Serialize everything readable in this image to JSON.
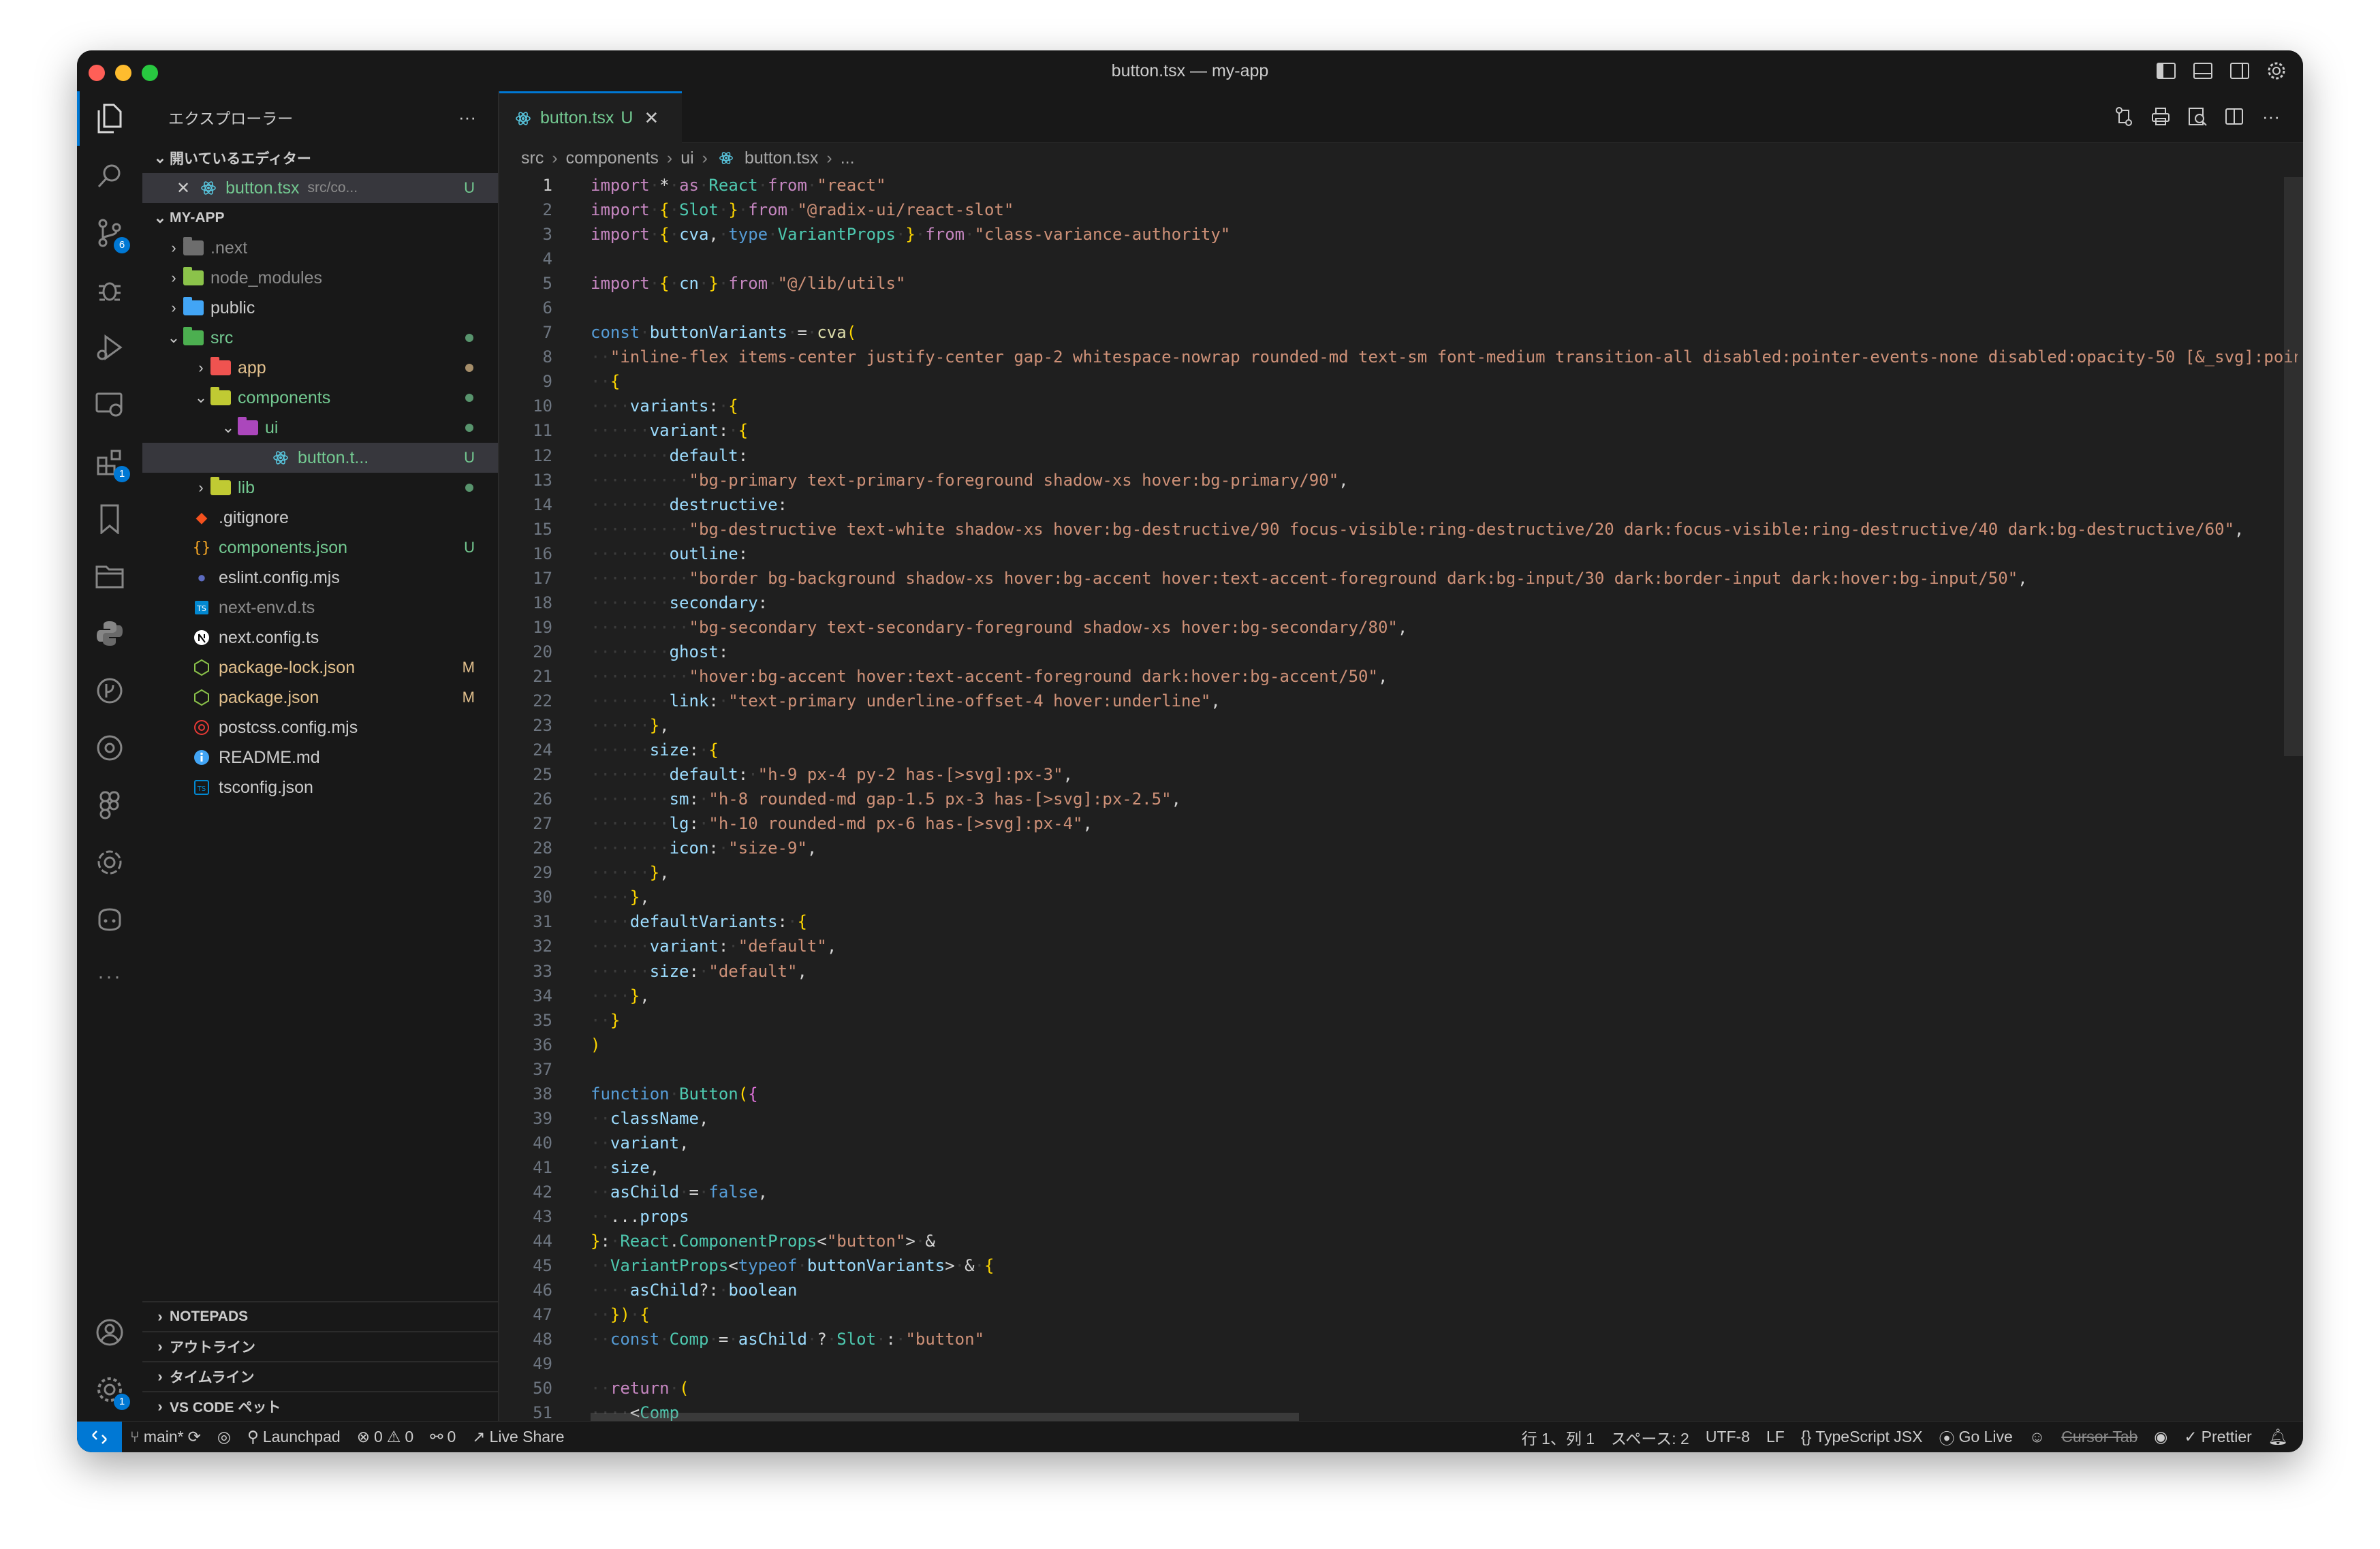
{
  "window": {
    "title": "button.tsx — my-app"
  },
  "sidebar": {
    "explorer_title": "エクスプローラー",
    "more": "···",
    "open_editors_title": "開いているエディター",
    "open_editor": {
      "name": "button.tsx",
      "path": "src/co...",
      "status": "U"
    },
    "project_title": "MY-APP",
    "tree": [
      {
        "name": ".next",
        "status": ""
      },
      {
        "name": "node_modules",
        "status": ""
      },
      {
        "name": "public",
        "status": ""
      },
      {
        "name": "src",
        "status": ""
      },
      {
        "name": "app",
        "status": ""
      },
      {
        "name": "components",
        "status": ""
      },
      {
        "name": "ui",
        "status": ""
      },
      {
        "name": "button.t...",
        "status": "U"
      },
      {
        "name": "lib",
        "status": ""
      },
      {
        "name": ".gitignore",
        "status": ""
      },
      {
        "name": "components.json",
        "status": "U"
      },
      {
        "name": "eslint.config.mjs",
        "status": ""
      },
      {
        "name": "next-env.d.ts",
        "status": ""
      },
      {
        "name": "next.config.ts",
        "status": ""
      },
      {
        "name": "package-lock.json",
        "status": "M"
      },
      {
        "name": "package.json",
        "status": "M"
      },
      {
        "name": "postcss.config.mjs",
        "status": ""
      },
      {
        "name": "README.md",
        "status": ""
      },
      {
        "name": "tsconfig.json",
        "status": ""
      }
    ],
    "bottom_sections": [
      "NOTEPADS",
      "アウトライン",
      "タイムライン",
      "VS CODE ペット"
    ]
  },
  "activity": {
    "scm_badge": "6",
    "extensions_badge": "1",
    "settings_badge": "1"
  },
  "editor": {
    "tab": {
      "name": "button.tsx",
      "status": "U",
      "close": "✕"
    },
    "breadcrumb": [
      "src",
      "components",
      "ui",
      "button.tsx",
      "..."
    ]
  },
  "code": {
    "lines": [
      "import * as React from \"react\"",
      "import { Slot } from \"@radix-ui/react-slot\"",
      "import { cva, type VariantProps } from \"class-variance-authority\"",
      "",
      "import { cn } from \"@/lib/utils\"",
      "",
      "const buttonVariants = cva(",
      "  \"inline-flex items-center justify-center gap-2 whitespace-nowrap rounded-md text-sm font-medium transition-all disabled:pointer-events-none disabled:opacity-50 [&_svg]:pointer-even",
      "  {",
      "    variants: {",
      "      variant: {",
      "        default:",
      "          \"bg-primary text-primary-foreground shadow-xs hover:bg-primary/90\",",
      "        destructive:",
      "          \"bg-destructive text-white shadow-xs hover:bg-destructive/90 focus-visible:ring-destructive/20 dark:focus-visible:ring-destructive/40 dark:bg-destructive/60\",",
      "        outline:",
      "          \"border bg-background shadow-xs hover:bg-accent hover:text-accent-foreground dark:bg-input/30 dark:border-input dark:hover:bg-input/50\",",
      "        secondary:",
      "          \"bg-secondary text-secondary-foreground shadow-xs hover:bg-secondary/80\",",
      "        ghost:",
      "          \"hover:bg-accent hover:text-accent-foreground dark:hover:bg-accent/50\",",
      "        link: \"text-primary underline-offset-4 hover:underline\",",
      "      },",
      "      size: {",
      "        default: \"h-9 px-4 py-2 has-[>svg]:px-3\",",
      "        sm: \"h-8 rounded-md gap-1.5 px-3 has-[>svg]:px-2.5\",",
      "        lg: \"h-10 rounded-md px-6 has-[>svg]:px-4\",",
      "        icon: \"size-9\",",
      "      },",
      "    },",
      "    defaultVariants: {",
      "      variant: \"default\",",
      "      size: \"default\",",
      "    },",
      "  }",
      ")",
      "",
      "function Button({",
      "  className,",
      "  variant,",
      "  size,",
      "  asChild = false,",
      "  ...props",
      "}: React.ComponentProps<\"button\"> &",
      "  VariantProps<typeof buttonVariants> & {",
      "    asChild?: boolean",
      "  }) {",
      "  const Comp = asChild ? Slot : \"button\"",
      "",
      "  return (",
      "    <Comp"
    ]
  },
  "statusbar": {
    "branch": "main*",
    "launchpad": "Launchpad",
    "errors": "0",
    "warnings": "0",
    "ports": "0",
    "live_share": "Live Share",
    "position": "行 1、列 1",
    "spaces": "スペース: 2",
    "encoding": "UTF-8",
    "eol": "LF",
    "language": "TypeScript JSX",
    "go_live": "Go Live",
    "cursor_tab": "Cursor Tab",
    "prettier": "Prettier"
  },
  "colors": {
    "accent": "#0078d4",
    "untracked": "#73c991",
    "modified": "#e2c08d",
    "editor_bg": "#1f1f1f",
    "sidebar_bg": "#181818"
  }
}
